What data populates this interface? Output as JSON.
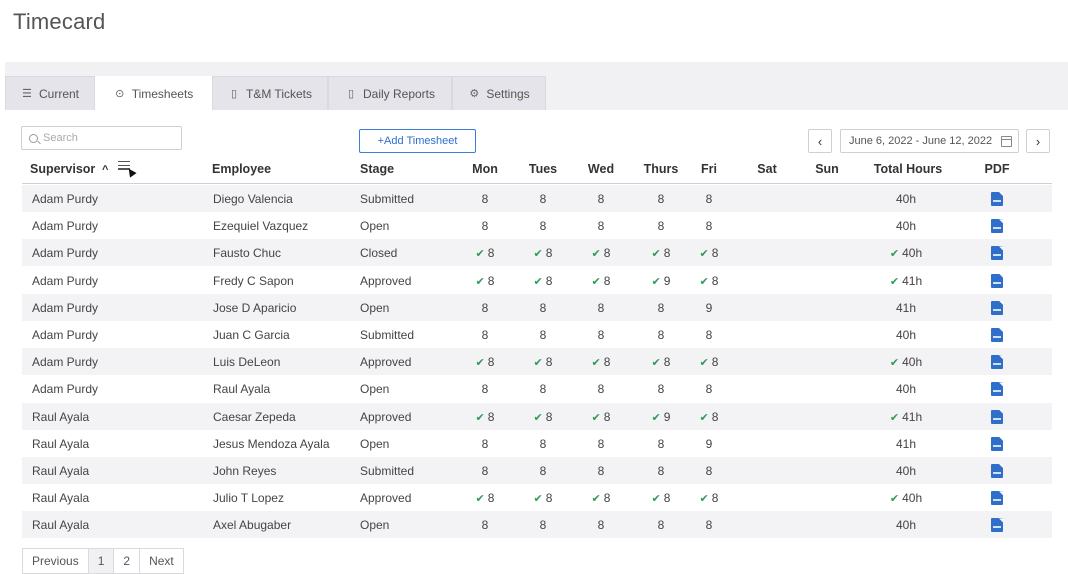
{
  "page": {
    "title": "Timecard"
  },
  "tabs": [
    {
      "label": "Current",
      "icon": "list-icon",
      "active": false
    },
    {
      "label": "Timesheets",
      "icon": "clock-check-icon",
      "active": true
    },
    {
      "label": "T&M Tickets",
      "icon": "document-icon",
      "active": false
    },
    {
      "label": "Daily Reports",
      "icon": "document-icon",
      "active": false
    },
    {
      "label": "Settings",
      "icon": "gear-icon",
      "active": false
    }
  ],
  "toolbar": {
    "search_placeholder": "Search",
    "add_label": "+Add Timesheet",
    "date_range": "June 6, 2022 - June 12, 2022",
    "prev_week": "‹",
    "next_week": "›"
  },
  "table": {
    "headers": {
      "supervisor": "Supervisor",
      "sort_indicator": "^",
      "employee": "Employee",
      "stage": "Stage",
      "mon": "Mon",
      "tues": "Tues",
      "wed": "Wed",
      "thurs": "Thurs",
      "fri": "Fri",
      "sat": "Sat",
      "sun": "Sun",
      "total": "Total Hours",
      "pdf": "PDF"
    },
    "rows": [
      {
        "supervisor": "Adam Purdy",
        "employee": "Diego Valencia",
        "stage": "Submitted",
        "days": [
          "8",
          "8",
          "8",
          "8",
          "8",
          "",
          ""
        ],
        "total": "40h",
        "checked": false
      },
      {
        "supervisor": "Adam Purdy",
        "employee": "Ezequiel Vazquez",
        "stage": "Open",
        "days": [
          "8",
          "8",
          "8",
          "8",
          "8",
          "",
          ""
        ],
        "total": "40h",
        "checked": false
      },
      {
        "supervisor": "Adam Purdy",
        "employee": "Fausto Chuc",
        "stage": "Closed",
        "days": [
          "8",
          "8",
          "8",
          "8",
          "8",
          "",
          ""
        ],
        "total": "40h",
        "checked": true
      },
      {
        "supervisor": "Adam Purdy",
        "employee": "Fredy C Sapon",
        "stage": "Approved",
        "days": [
          "8",
          "8",
          "8",
          "9",
          "8",
          "",
          ""
        ],
        "total": "41h",
        "checked": true
      },
      {
        "supervisor": "Adam Purdy",
        "employee": "Jose D Aparicio",
        "stage": "Open",
        "days": [
          "8",
          "8",
          "8",
          "8",
          "9",
          "",
          ""
        ],
        "total": "41h",
        "checked": false
      },
      {
        "supervisor": "Adam Purdy",
        "employee": "Juan C Garcia",
        "stage": "Submitted",
        "days": [
          "8",
          "8",
          "8",
          "8",
          "8",
          "",
          ""
        ],
        "total": "40h",
        "checked": false
      },
      {
        "supervisor": "Adam Purdy",
        "employee": "Luis DeLeon",
        "stage": "Approved",
        "days": [
          "8",
          "8",
          "8",
          "8",
          "8",
          "",
          ""
        ],
        "total": "40h",
        "checked": true
      },
      {
        "supervisor": "Adam Purdy",
        "employee": "Raul Ayala",
        "stage": "Open",
        "days": [
          "8",
          "8",
          "8",
          "8",
          "8",
          "",
          ""
        ],
        "total": "40h",
        "checked": false
      },
      {
        "supervisor": "Raul Ayala",
        "employee": "Caesar Zepeda",
        "stage": "Approved",
        "days": [
          "8",
          "8",
          "8",
          "9",
          "8",
          "",
          ""
        ],
        "total": "41h",
        "checked": true
      },
      {
        "supervisor": "Raul Ayala",
        "employee": "Jesus Mendoza Ayala",
        "stage": "Open",
        "days": [
          "8",
          "8",
          "8",
          "8",
          "9",
          "",
          ""
        ],
        "total": "41h",
        "checked": false
      },
      {
        "supervisor": "Raul Ayala",
        "employee": "John Reyes",
        "stage": "Submitted",
        "days": [
          "8",
          "8",
          "8",
          "8",
          "8",
          "",
          ""
        ],
        "total": "40h",
        "checked": false
      },
      {
        "supervisor": "Raul Ayala",
        "employee": "Julio T Lopez",
        "stage": "Approved",
        "days": [
          "8",
          "8",
          "8",
          "8",
          "8",
          "",
          ""
        ],
        "total": "40h",
        "checked": true
      },
      {
        "supervisor": "Raul Ayala",
        "employee": "Axel Abugaber",
        "stage": "Open",
        "days": [
          "8",
          "8",
          "8",
          "8",
          "8",
          "",
          ""
        ],
        "total": "40h",
        "checked": false
      }
    ]
  },
  "pagination": {
    "previous": "Previous",
    "pages": [
      "1",
      "2"
    ],
    "next": "Next",
    "current": "1"
  },
  "colors": {
    "accent": "#2f6fc9",
    "check": "#2e9b57",
    "row_alt": "#f3f3f5"
  },
  "icons": {
    "check": "check-icon",
    "pdf": "pdf-file-icon",
    "search": "search-icon",
    "calendar": "calendar-icon",
    "sort": "sort-filter-icon"
  }
}
